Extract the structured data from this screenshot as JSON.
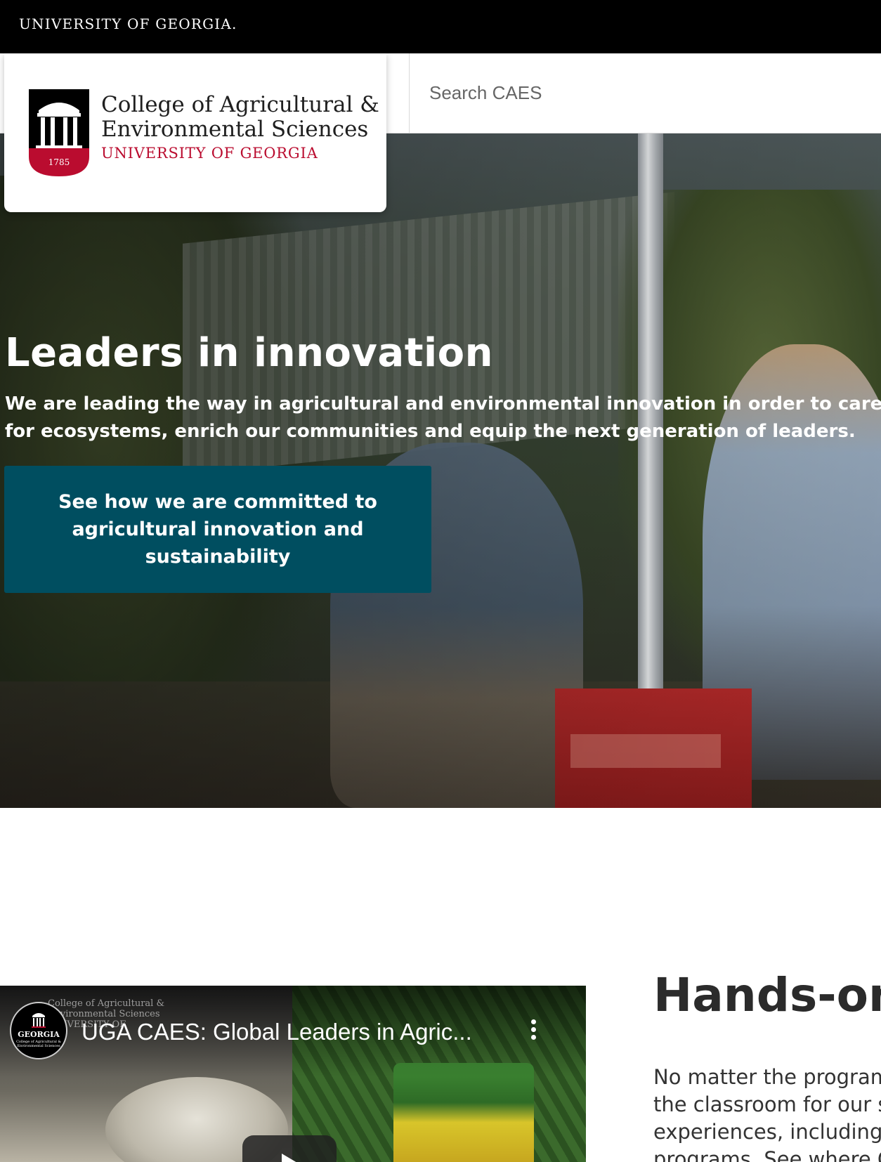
{
  "topbar": {
    "brand": "UNIVERSITY OF GEORGIA."
  },
  "logo": {
    "college_line1": "College of Agricultural &",
    "college_line2": "Environmental Sciences",
    "university": "UNIVERSITY OF GEORGIA",
    "year": "1785",
    "colors": {
      "red": "#ba0c2f",
      "black": "#000000"
    }
  },
  "search": {
    "placeholder": "Search CAES"
  },
  "hero": {
    "title": "Leaders in innovation",
    "subtitle": "We are leading the way in agricultural and environmental innovation in order to care for ecosystems, enrich our communities and equip the next generation of leaders.",
    "cta_label": "See how we are committed to agricultural innovation and sustainability",
    "cta_color": "#004e60"
  },
  "video": {
    "title": "UGA CAES: Global Leaders in Agric...",
    "channel": {
      "name": "GEORGIA",
      "sub": "College of Agricultural & Environmental Sciences"
    },
    "watermark": "College of Agricultural & Environmental Sciences UNIVERSITY OF GEORGIA",
    "icons": [
      "more-vert-icon",
      "play-icon"
    ]
  },
  "handson": {
    "title": "Hands-on",
    "body": "No matter the program, the classroom for our st experiences, including ir programs. See where CA"
  }
}
